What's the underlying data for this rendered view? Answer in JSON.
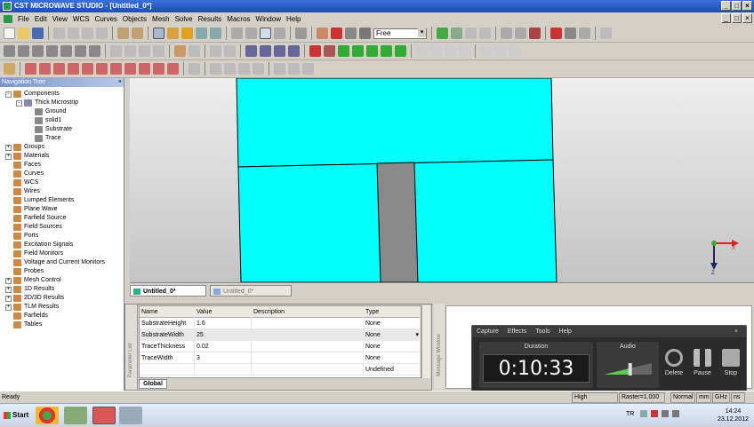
{
  "window": {
    "title": "CST MICROWAVE STUDIO - [Untitled_0*]",
    "controls": [
      "_",
      "□",
      "×"
    ]
  },
  "menu": [
    "File",
    "Edit",
    "View",
    "WCS",
    "Curves",
    "Objects",
    "Mesh",
    "Solve",
    "Results",
    "Macros",
    "Window",
    "Help"
  ],
  "toolbar": {
    "view_mode": "Free"
  },
  "nav": {
    "title": "Navigation Tree",
    "items": [
      {
        "label": "Components",
        "indent": 0,
        "expand": "-",
        "color": "#c84"
      },
      {
        "label": "Thick Microstrip",
        "indent": 1,
        "expand": "-",
        "color": "#88a"
      },
      {
        "label": "Ground",
        "indent": 2,
        "expand": "",
        "color": "#888"
      },
      {
        "label": "solid1",
        "indent": 2,
        "expand": "",
        "color": "#888"
      },
      {
        "label": "Substrate",
        "indent": 2,
        "expand": "",
        "color": "#888"
      },
      {
        "label": "Trace",
        "indent": 2,
        "expand": "",
        "color": "#888"
      },
      {
        "label": "Groups",
        "indent": 0,
        "expand": "+",
        "color": "#c84"
      },
      {
        "label": "Materials",
        "indent": 0,
        "expand": "+",
        "color": "#c84"
      },
      {
        "label": "Faces",
        "indent": 0,
        "expand": "",
        "color": "#c84"
      },
      {
        "label": "Curves",
        "indent": 0,
        "expand": "",
        "color": "#c84"
      },
      {
        "label": "WCS",
        "indent": 0,
        "expand": "",
        "color": "#c84"
      },
      {
        "label": "Wires",
        "indent": 0,
        "expand": "",
        "color": "#c84"
      },
      {
        "label": "Lumped Elements",
        "indent": 0,
        "expand": "",
        "color": "#c84"
      },
      {
        "label": "Plane Wave",
        "indent": 0,
        "expand": "",
        "color": "#c84"
      },
      {
        "label": "Farfield Source",
        "indent": 0,
        "expand": "",
        "color": "#c84"
      },
      {
        "label": "Field Sources",
        "indent": 0,
        "expand": "",
        "color": "#c84"
      },
      {
        "label": "Ports",
        "indent": 0,
        "expand": "",
        "color": "#c84"
      },
      {
        "label": "Excitation Signals",
        "indent": 0,
        "expand": "",
        "color": "#c84"
      },
      {
        "label": "Field Monitors",
        "indent": 0,
        "expand": "",
        "color": "#c84"
      },
      {
        "label": "Voltage and Current Monitors",
        "indent": 0,
        "expand": "",
        "color": "#c84"
      },
      {
        "label": "Probes",
        "indent": 0,
        "expand": "",
        "color": "#c84"
      },
      {
        "label": "Mesh Control",
        "indent": 0,
        "expand": "+",
        "color": "#c84"
      },
      {
        "label": "1D Results",
        "indent": 0,
        "expand": "+",
        "color": "#c84"
      },
      {
        "label": "2D/3D Results",
        "indent": 0,
        "expand": "+",
        "color": "#c84"
      },
      {
        "label": "TLM Results",
        "indent": 0,
        "expand": "+",
        "color": "#c84"
      },
      {
        "label": "Farfields",
        "indent": 0,
        "expand": "",
        "color": "#c84"
      },
      {
        "label": "Tables",
        "indent": 0,
        "expand": "",
        "color": "#c84"
      }
    ]
  },
  "axis": {
    "x": "X",
    "z": "Z"
  },
  "tabs": [
    {
      "label": "Untitled_0*"
    },
    {
      "label": "Untitled_0*"
    }
  ],
  "params": {
    "headers": [
      "Name",
      "Value",
      "Description",
      "Type"
    ],
    "rows": [
      {
        "name": "SubstrateHeight",
        "value": "1.6",
        "desc": "",
        "type": "None"
      },
      {
        "name": "SubstrateWidth",
        "value": "25",
        "desc": "",
        "type": "None"
      },
      {
        "name": "TraceThickness",
        "value": "0.02",
        "desc": "",
        "type": "None"
      },
      {
        "name": "TraceWidth",
        "value": "3",
        "desc": "",
        "type": "None"
      },
      {
        "name": "",
        "value": "",
        "desc": "",
        "type": "Undefined"
      }
    ],
    "tab": "Global",
    "side_label": "Parameter List"
  },
  "message": {
    "side_label": "Message Window"
  },
  "recorder": {
    "menu": [
      "Capture",
      "Effects",
      "Tools",
      "Help"
    ],
    "duration_label": "Duration",
    "duration": "0:10:33",
    "audio_label": "Audio",
    "audio_level": 0.55,
    "controls": [
      "Delete",
      "Pause",
      "Stop"
    ]
  },
  "status": {
    "left": "Ready",
    "items": [
      "High Frequency",
      "Raster=1.000",
      "Normal",
      "mm",
      "GHz",
      "ns"
    ]
  },
  "taskbar": {
    "start": "Start",
    "lang": "TR",
    "time": "14:24",
    "date": "23.12.2012"
  }
}
